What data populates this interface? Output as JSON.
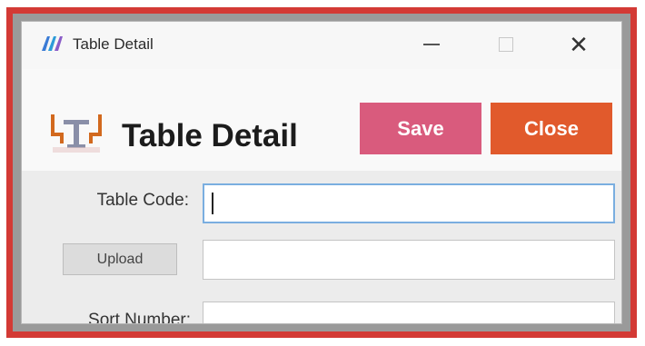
{
  "window": {
    "title": "Table Detail",
    "controls": {
      "minimize": "minimize",
      "maximize": "maximize",
      "close": "close"
    }
  },
  "header": {
    "icon": "dining-table-icon",
    "title": "Table Detail",
    "save_label": "Save",
    "close_label": "Close"
  },
  "form": {
    "table_code_label": "Table Code:",
    "table_code_value": "",
    "upload_label": "Upload",
    "upload_value": "",
    "sort_number_label": "Sort Number:",
    "sort_number_value": ""
  },
  "colors": {
    "frame_highlight": "#d33a35",
    "save_button": "#d95b7d",
    "close_button": "#e15a2c",
    "focus_border": "#7aaee0"
  }
}
